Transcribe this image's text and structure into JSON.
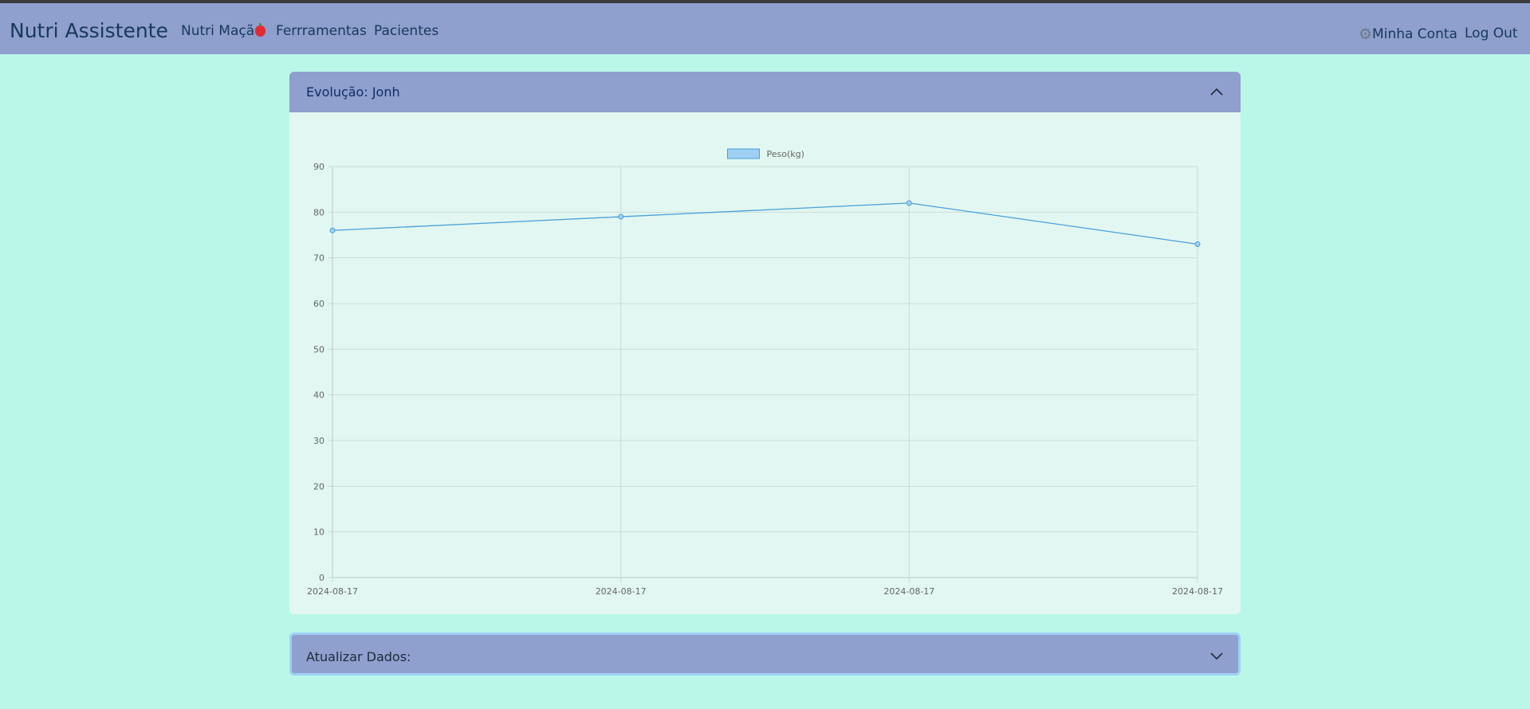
{
  "navbar": {
    "brand": "Nutri Assistente",
    "links": [
      "Nutri Maçã",
      "Ferrramentas",
      "Pacientes"
    ],
    "account": "Minha Conta",
    "logout": "Log Out"
  },
  "evolucao": {
    "title": "Evolução: Jonh",
    "chevron_icon": "chevron-up-icon"
  },
  "atualizar": {
    "title": "Atualizar Dados:",
    "chevron_icon": "chevron-down-icon"
  },
  "colors": {
    "navbar_bg": "#8f9fce",
    "page_bg": "#baf7e9",
    "card_bg": "#e2f7f1",
    "series_line": "#4a9fd8",
    "series_fill": "#9fd0f4"
  },
  "chart_data": {
    "type": "line",
    "title": "",
    "xlabel": "",
    "ylabel": "",
    "x": [
      "2024-08-17",
      "2024-08-17",
      "2024-08-17",
      "2024-08-17"
    ],
    "series": [
      {
        "name": "Peso(kg)",
        "values": [
          76,
          79,
          82,
          73
        ]
      }
    ],
    "ylim": [
      0,
      90
    ],
    "yticks": [
      0,
      10,
      20,
      30,
      40,
      50,
      60,
      70,
      80,
      90
    ],
    "grid": true,
    "legend": "top-center"
  }
}
